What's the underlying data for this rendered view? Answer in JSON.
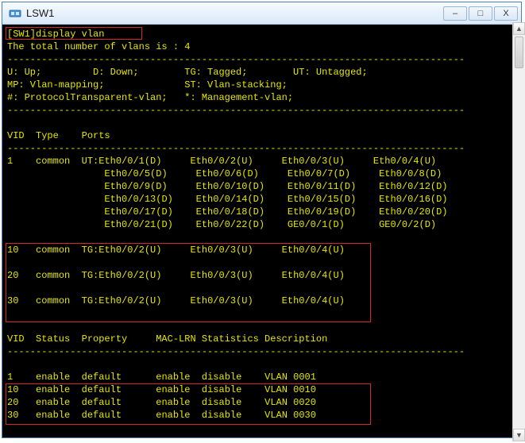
{
  "window": {
    "title": "LSW1"
  },
  "terminal": {
    "prompt_host": "[SW1]",
    "command": "display vlan",
    "total_line": "The total number of vlans is : 4",
    "dash_line": "--------------------------------------------------------------------------------",
    "legend": [
      "U: Up;         D: Down;        TG: Tagged;        UT: Untagged;",
      "MP: Vlan-mapping;              ST: Vlan-stacking;",
      "#: ProtocolTransparent-vlan;   *: Management-vlan;"
    ],
    "ports_header": "VID  Type    Ports",
    "vlan1": {
      "vid": "1",
      "type": "common",
      "rows": [
        "UT:Eth0/0/1(D)     Eth0/0/2(U)     Eth0/0/3(U)     Eth0/0/4(U)",
        "   Eth0/0/5(D)     Eth0/0/6(D)     Eth0/0/7(D)     Eth0/0/8(D)",
        "   Eth0/0/9(D)     Eth0/0/10(D)    Eth0/0/11(D)    Eth0/0/12(D)",
        "   Eth0/0/13(D)    Eth0/0/14(D)    Eth0/0/15(D)    Eth0/0/16(D)",
        "   Eth0/0/17(D)    Eth0/0/18(D)    Eth0/0/19(D)    Eth0/0/20(D)",
        "   Eth0/0/21(D)    Eth0/0/22(D)    GE0/0/1(D)      GE0/0/2(D)"
      ]
    },
    "tagged_vlans": [
      {
        "vid": "10",
        "type": "common",
        "ports": "TG:Eth0/0/2(U)     Eth0/0/3(U)     Eth0/0/4(U)"
      },
      {
        "vid": "20",
        "type": "common",
        "ports": "TG:Eth0/0/2(U)     Eth0/0/3(U)     Eth0/0/4(U)"
      },
      {
        "vid": "30",
        "type": "common",
        "ports": "TG:Eth0/0/2(U)     Eth0/0/3(U)     Eth0/0/4(U)"
      }
    ],
    "status_header": "VID  Status  Property     MAC-LRN Statistics Description",
    "status_rows": [
      {
        "vid": "1",
        "status": "enable",
        "prop": "default",
        "mac": "enable",
        "stat": "disable",
        "desc": "VLAN 0001"
      },
      {
        "vid": "10",
        "status": "enable",
        "prop": "default",
        "mac": "enable",
        "stat": "disable",
        "desc": "VLAN 0010"
      },
      {
        "vid": "20",
        "status": "enable",
        "prop": "default",
        "mac": "enable",
        "stat": "disable",
        "desc": "VLAN 0020"
      },
      {
        "vid": "30",
        "status": "enable",
        "prop": "default",
        "mac": "enable",
        "stat": "disable",
        "desc": "VLAN 0030"
      }
    ]
  }
}
